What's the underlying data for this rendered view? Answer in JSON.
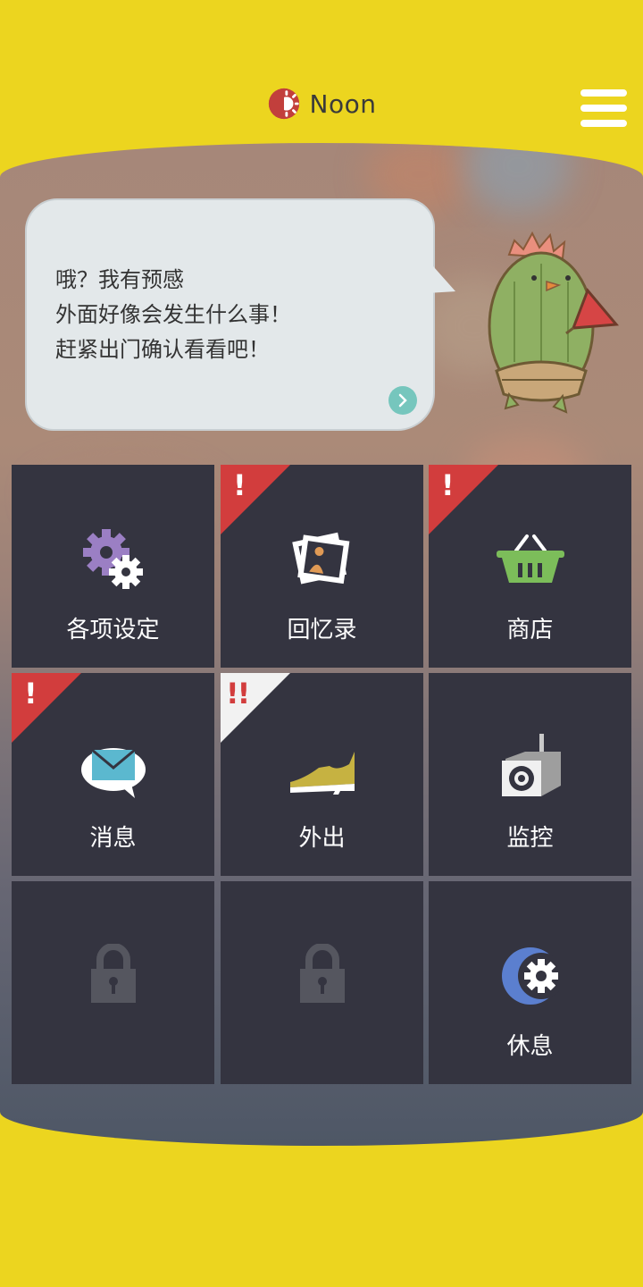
{
  "header": {
    "time_label": "Noon",
    "time_icon": "sun-half-icon",
    "menu_icon": "hamburger-menu-icon"
  },
  "bubble": {
    "lines": [
      "哦？我有预感",
      "外面好像会发生什么事！",
      "赶紧出门确认看看吧！"
    ],
    "next_icon": "chevron-right-icon"
  },
  "menu": [
    {
      "label": "各项设定",
      "icon": "gears-icon",
      "badge": ""
    },
    {
      "label": "回忆录",
      "icon": "photos-icon",
      "badge": "!"
    },
    {
      "label": "商店",
      "icon": "basket-icon",
      "badge": "!"
    },
    {
      "label": "消息",
      "icon": "mail-bubble-icon",
      "badge": "!"
    },
    {
      "label": "外出",
      "icon": "shoe-icon",
      "badge": "!!"
    },
    {
      "label": "监控",
      "icon": "camera-speaker-icon",
      "badge": ""
    },
    {
      "label": "",
      "icon": "lock-icon",
      "badge": ""
    },
    {
      "label": "",
      "icon": "lock-icon",
      "badge": ""
    },
    {
      "label": "休息",
      "icon": "moon-gear-icon",
      "badge": ""
    }
  ],
  "colors": {
    "background": "#ecd51f",
    "tile": "#343440",
    "badge_red": "#d23d3d",
    "badge_white": "#f2f2f2",
    "accent_teal": "#76c6bd"
  }
}
